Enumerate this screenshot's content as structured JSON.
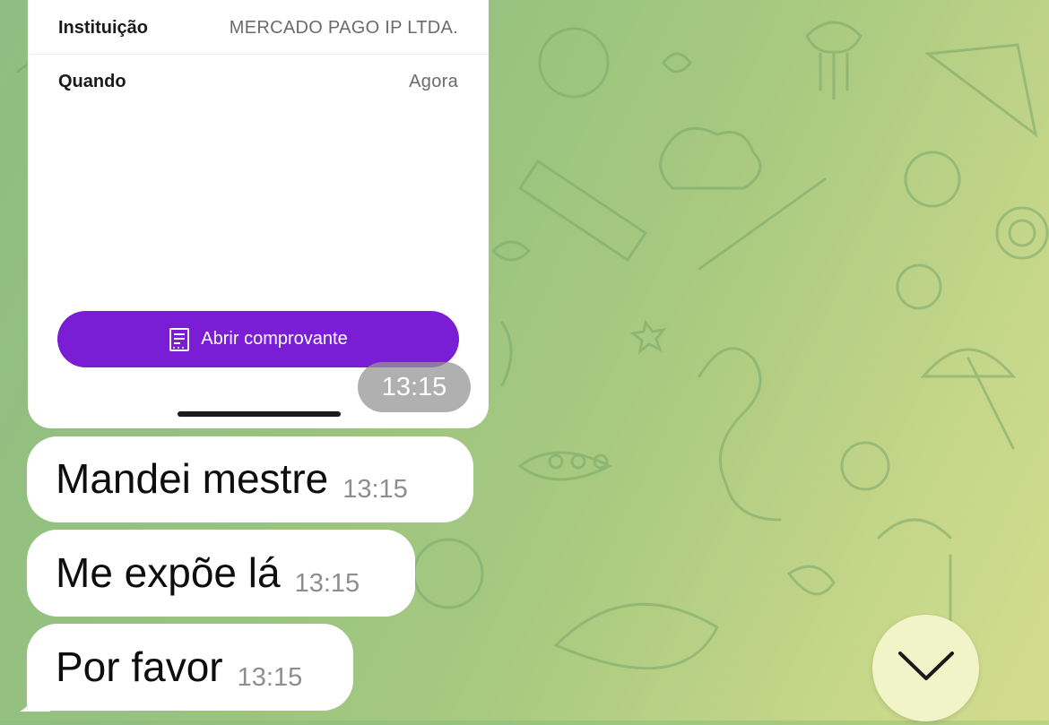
{
  "card": {
    "institution_label": "Instituição",
    "institution_value": "MERCADO PAGO IP LTDA.",
    "when_label": "Quando",
    "when_value": "Agora",
    "button_label": "Abrir comprovante",
    "button_color": "#7a1ed6",
    "timestamp": "13:15"
  },
  "messages": [
    {
      "text": "Mandei mestre",
      "time": "13:15"
    },
    {
      "text": "Me expõe lá",
      "time": "13:15"
    },
    {
      "text": "Por favor",
      "time": "13:15"
    }
  ],
  "icons": {
    "receipt": "receipt-icon",
    "scroll_down": "chevron-down-icon"
  },
  "colors": {
    "wallpaper_start": "#8fbd83",
    "wallpaper_end": "#d3dc8e",
    "bubble": "#ffffff"
  }
}
